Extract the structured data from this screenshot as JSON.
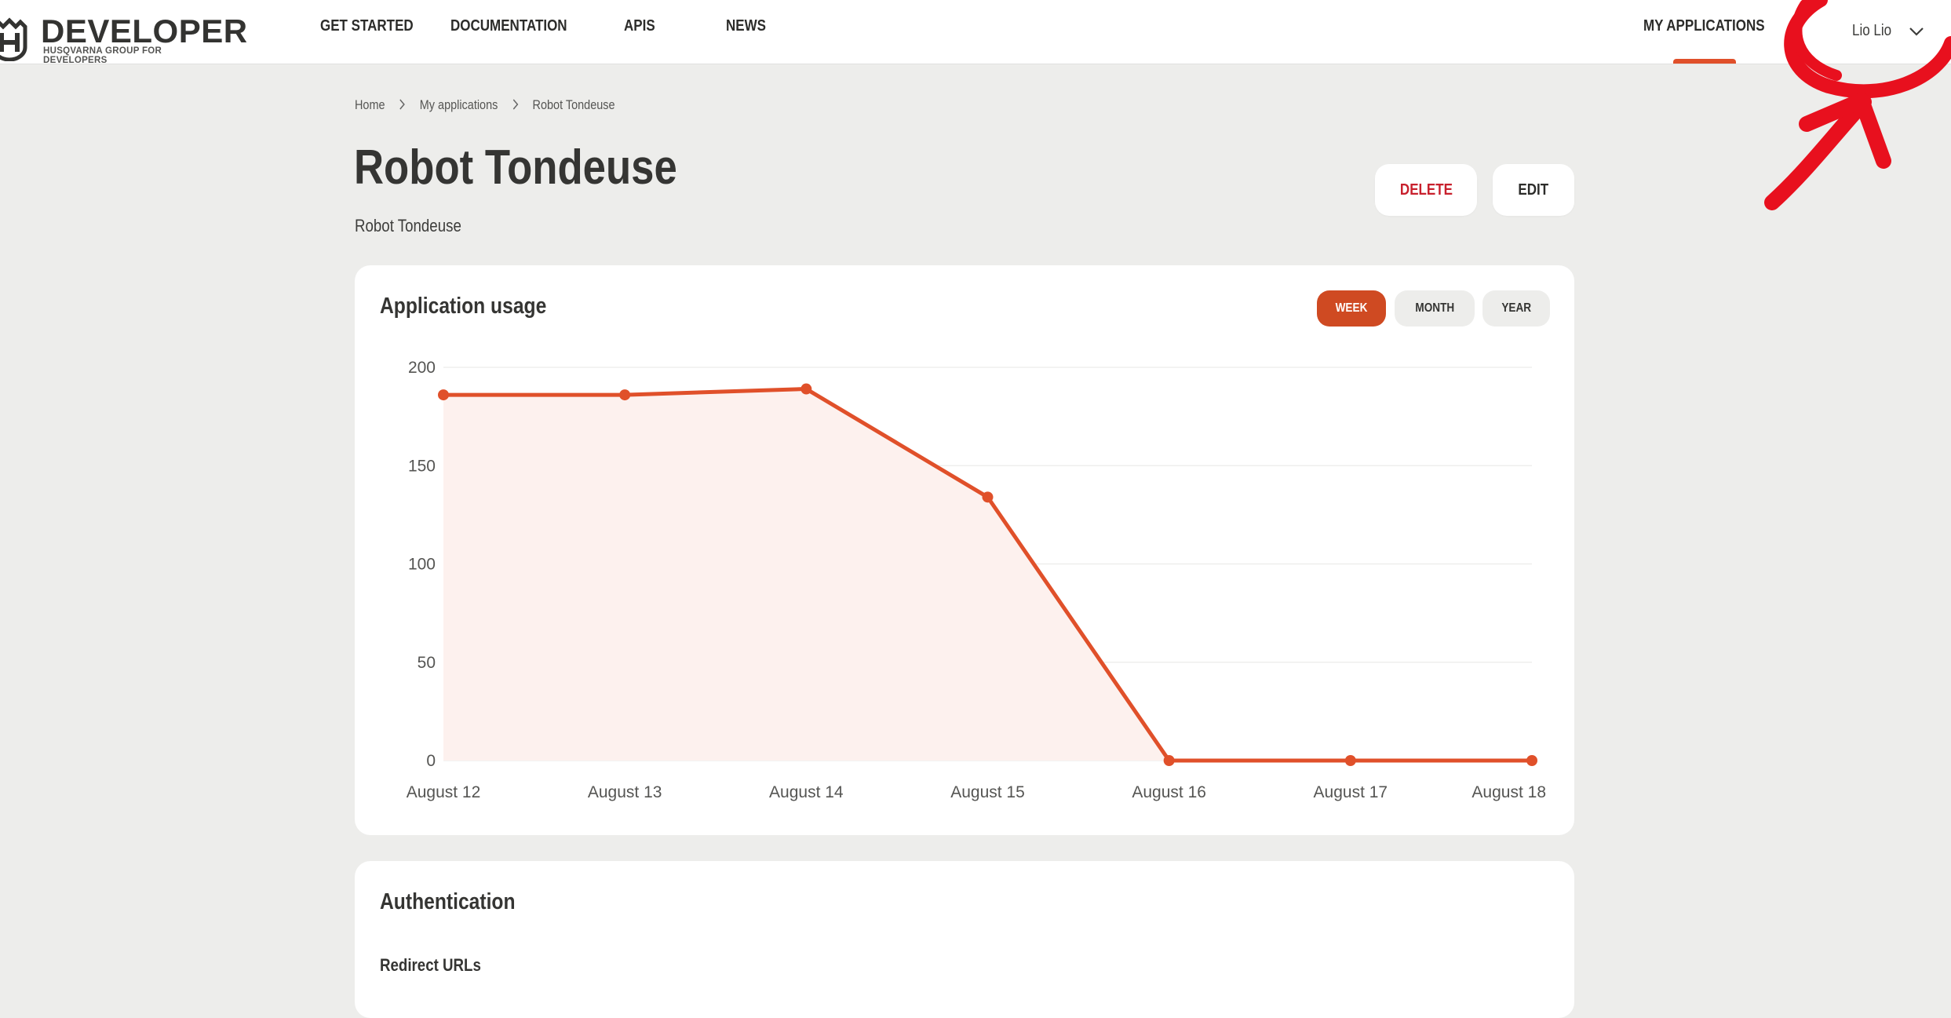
{
  "header": {
    "logo_title": "DEVELOPER",
    "logo_subtitle": "HUSQVARNA GROUP FOR DEVELOPERS",
    "nav": {
      "get_started": "GET STARTED",
      "documentation": "DOCUMENTATION",
      "apis": "APIS",
      "news": "NEWS",
      "my_applications": "MY APPLICATIONS"
    },
    "user_name": "Lio Lio"
  },
  "breadcrumb": {
    "home": "Home",
    "my_applications": "My applications",
    "current": "Robot Tondeuse"
  },
  "page": {
    "title": "Robot Tondeuse",
    "description": "Robot Tondeuse",
    "delete_label": "DELETE",
    "edit_label": "EDIT"
  },
  "usage": {
    "title": "Application usage",
    "ranges": {
      "week": "WEEK",
      "month": "MONTH",
      "year": "YEAR"
    },
    "active_range": "week"
  },
  "auth": {
    "title": "Authentication",
    "redirect_urls_label": "Redirect URLs"
  },
  "colors": {
    "accent": "#e0502a",
    "active_button": "#cf4a22",
    "delete_text": "#c8202d",
    "area_fill": "#fdf1ee",
    "annotation": "#e8101e"
  },
  "chart_data": {
    "type": "area",
    "categories": [
      "August 12",
      "August 13",
      "August 14",
      "August 15",
      "August 16",
      "August 17",
      "August 18"
    ],
    "values": [
      186,
      186,
      189,
      134,
      0,
      0,
      0
    ],
    "yticks": [
      0,
      50,
      100,
      150,
      200
    ],
    "ylim": [
      0,
      200
    ],
    "grid": true,
    "xlabel": "",
    "ylabel": ""
  }
}
